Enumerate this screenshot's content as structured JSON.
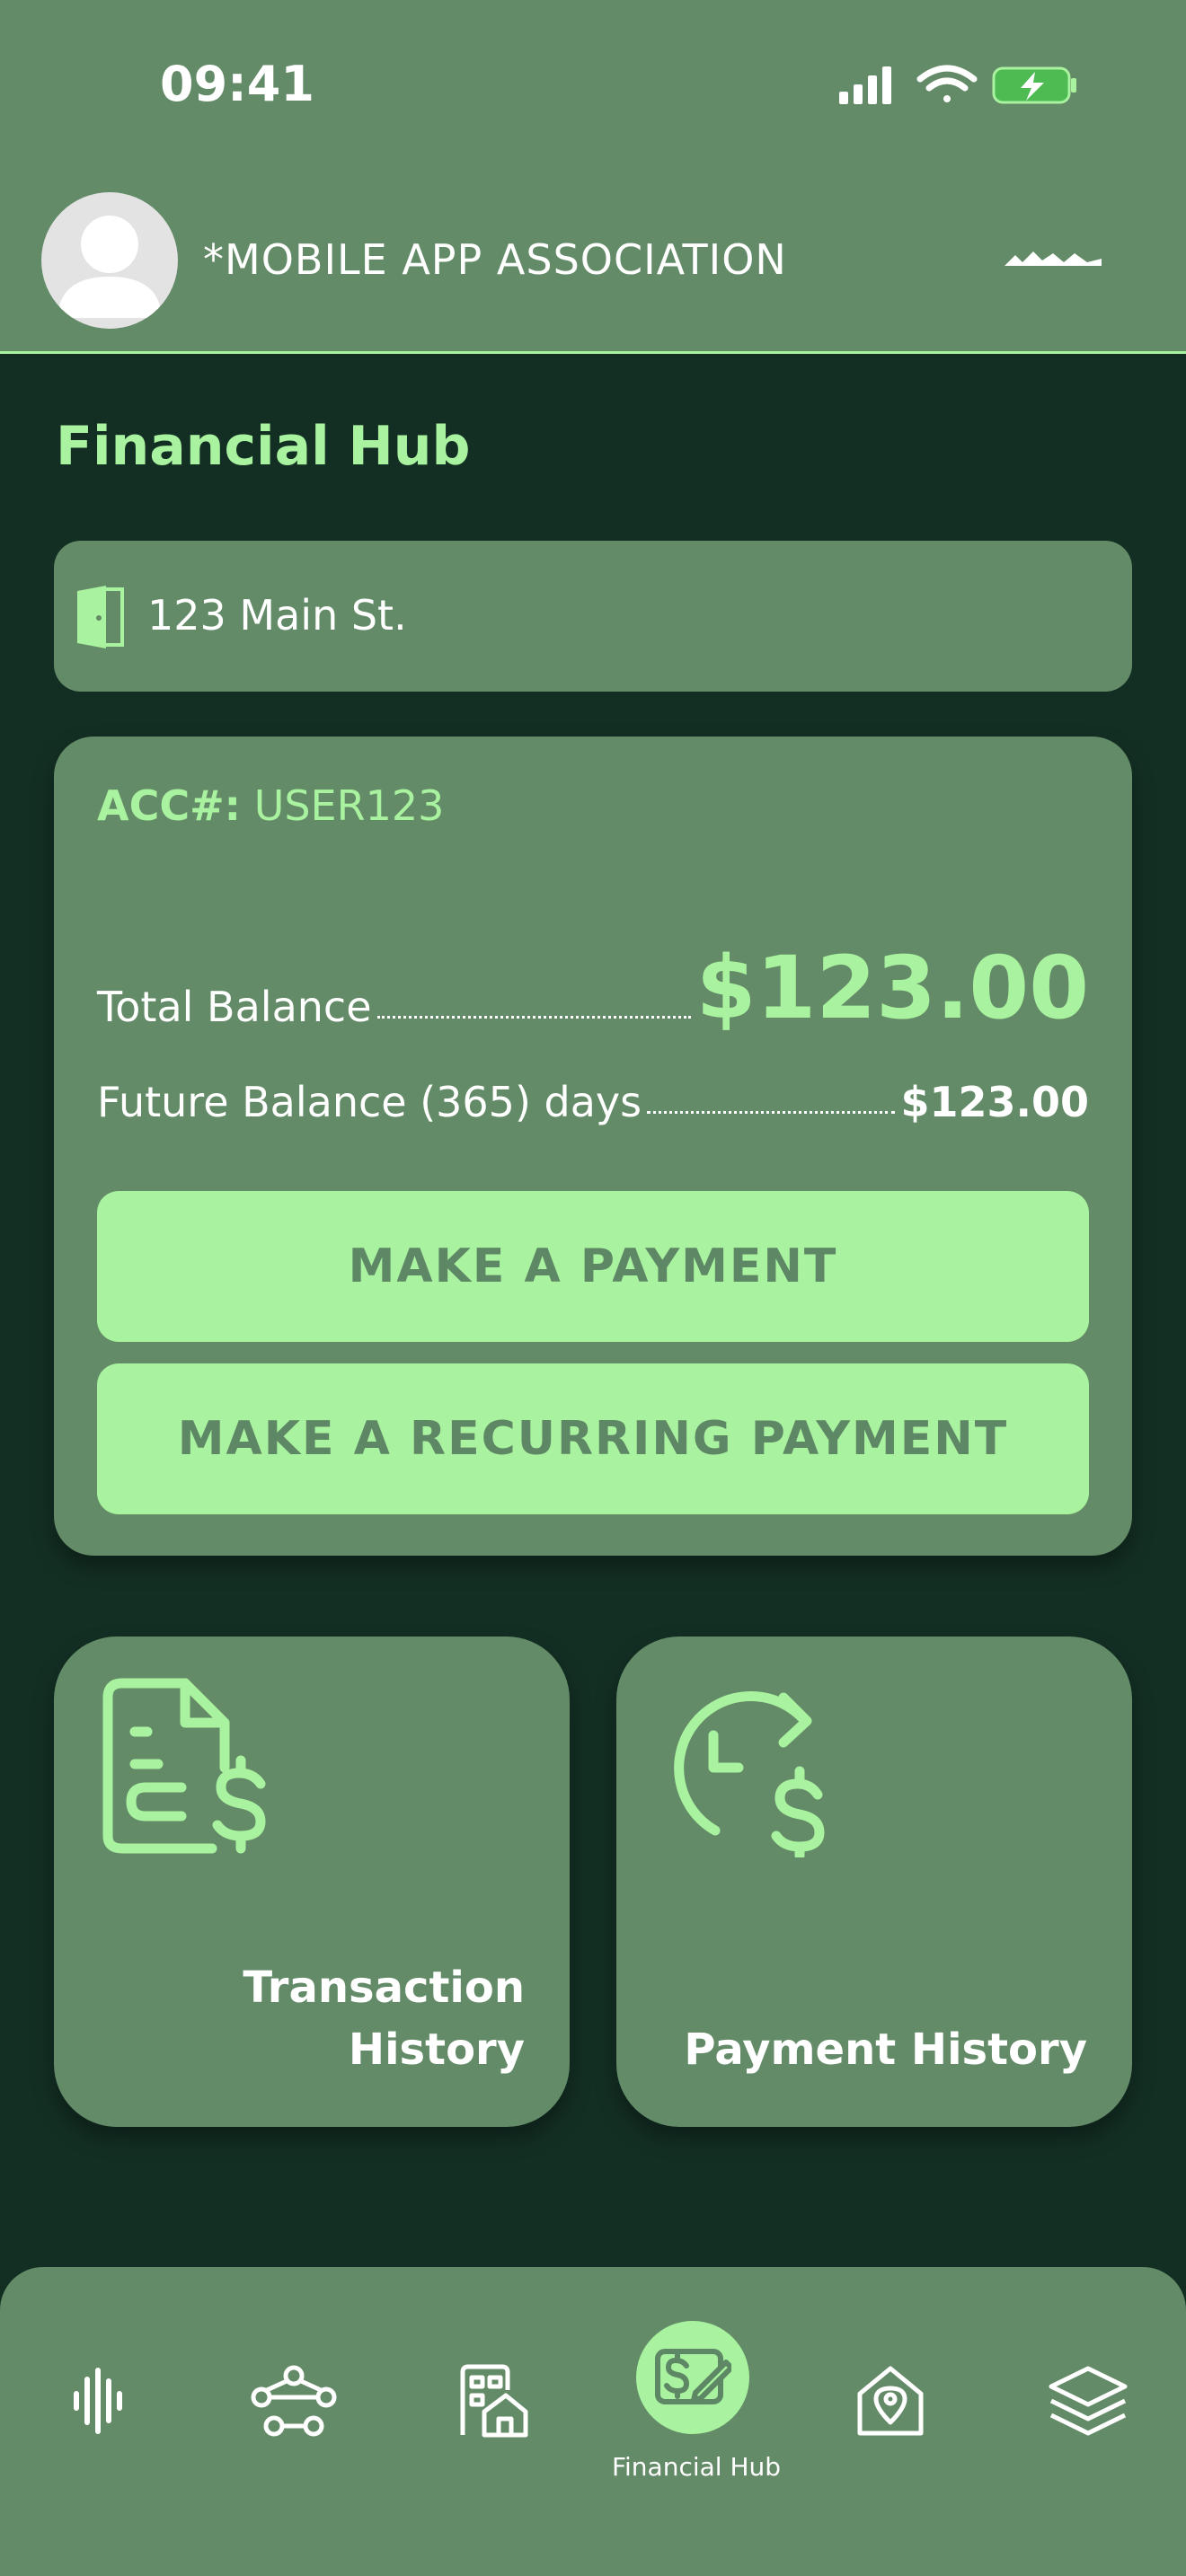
{
  "status_bar": {
    "time": "09:41",
    "icons": [
      "signal-icon",
      "wifi-icon",
      "battery-charging-icon"
    ]
  },
  "header": {
    "org_name": "*MOBILE APP ASSOCIATION",
    "avatar": "avatar-icon",
    "logo": "logo-mark"
  },
  "page": {
    "title": "Financial Hub"
  },
  "address": {
    "icon": "door-icon",
    "text": "123 Main St."
  },
  "account": {
    "acc_label": "ACC#:",
    "acc_value": "USER123",
    "total_label": "Total Balance",
    "total_amount": "$123.00",
    "future_label": "Future Balance (365) days",
    "future_amount": "$123.00",
    "pay_button": "MAKE A PAYMENT",
    "recurring_button": "MAKE A RECURRING PAYMENT"
  },
  "tiles": [
    {
      "icon": "transaction-history-icon",
      "label_line1": "Transaction",
      "label_line2": "History"
    },
    {
      "icon": "payment-history-icon",
      "label": "Payment History"
    }
  ],
  "bottom_nav": {
    "items": [
      "audio-wave-icon",
      "network-icon",
      "buildings-icon",
      "financial-hub-icon",
      "location-home-icon",
      "layers-icon"
    ],
    "active_label": "Financial Hub"
  },
  "colors": {
    "header_bg": "#638b67",
    "page_bg": "#132f24",
    "accent": "#a9f29f",
    "button_text": "#5e8765"
  }
}
